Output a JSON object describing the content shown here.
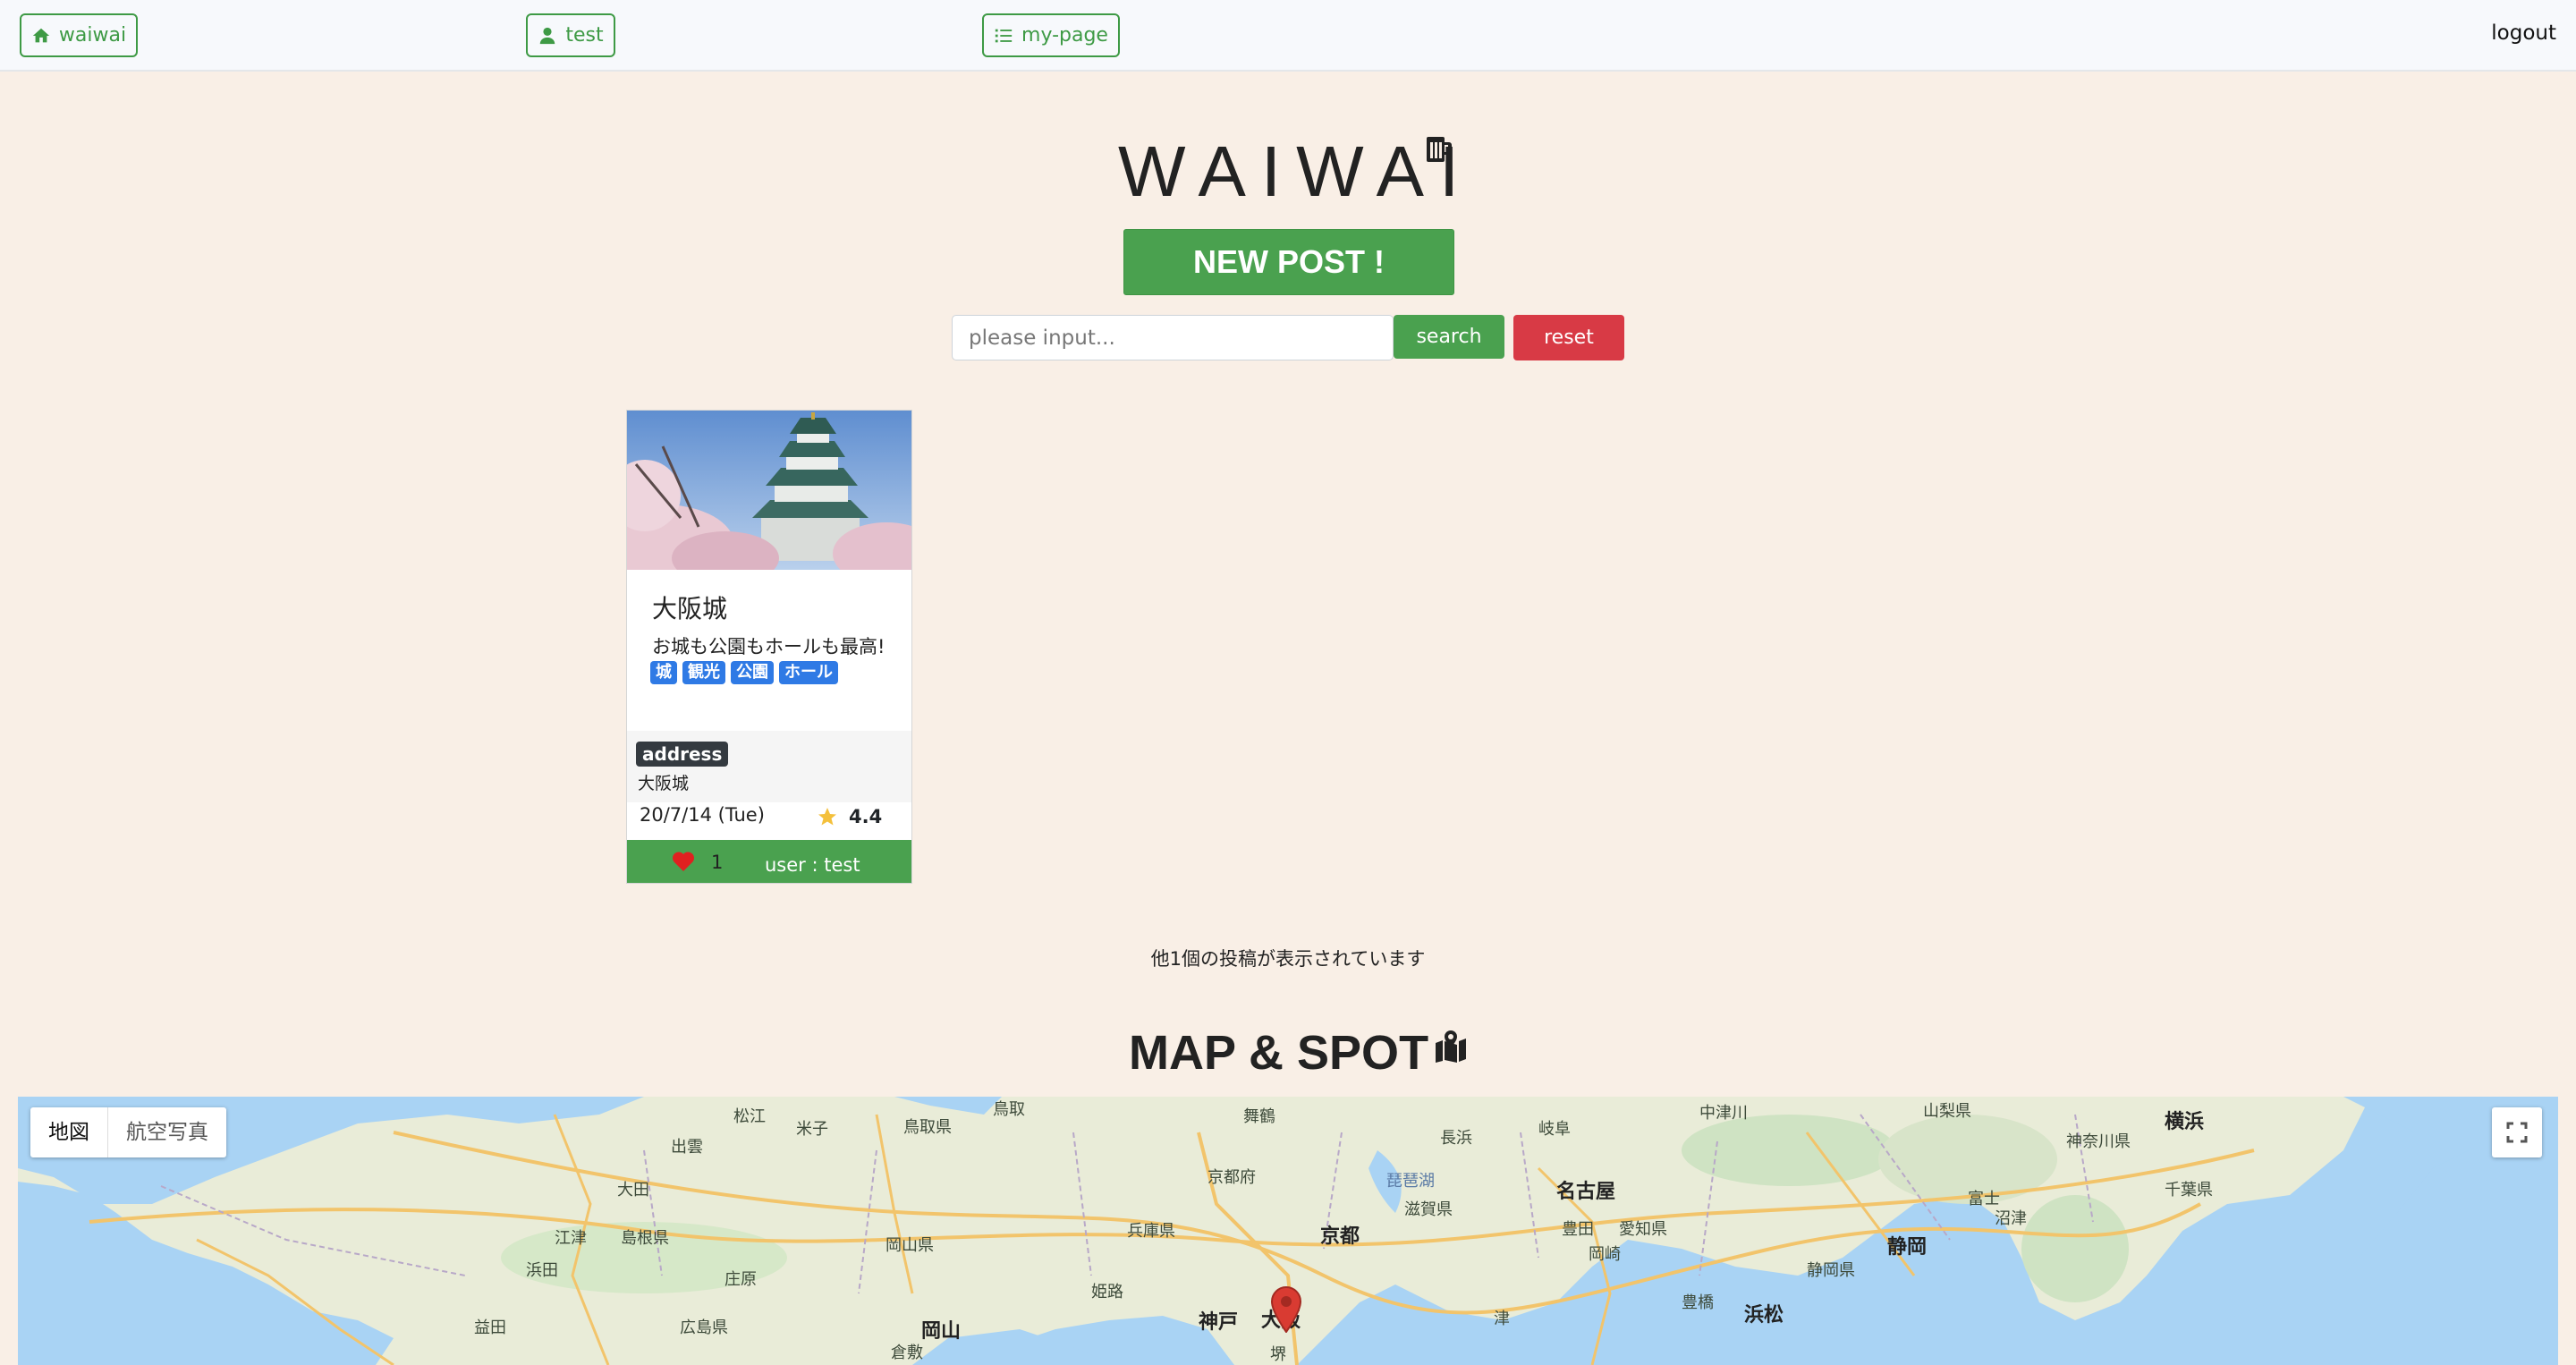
{
  "navbar": {
    "home_label": "waiwai",
    "user_label": "test",
    "mypage_label": "my-page",
    "logout_label": "logout"
  },
  "header": {
    "logo_text": "WAIWAI",
    "new_post_label": "NEW POST !",
    "search_placeholder": "please input...",
    "search_label": "search",
    "reset_label": "reset"
  },
  "post": {
    "title": "大阪城",
    "description": "お城も公園もホールも最高!",
    "tags": [
      "城",
      "観光",
      "公園",
      "ホール"
    ],
    "address_label": "address",
    "address": "大阪城",
    "date": "20/7/14 (Tue)",
    "rating": "4.4",
    "likes": "1",
    "user": "user : test"
  },
  "count_text": "他1個の投稿が表示されています",
  "map": {
    "title": "MAP & SPOT",
    "type_map": "地図",
    "type_satellite": "航空写真",
    "labels": {
      "matsue": "松江",
      "yonago": "米子",
      "tottori_city": "鳥取",
      "tottori_pref": "鳥取県",
      "maizuru": "舞鶴",
      "nagahama": "長浜",
      "gifu": "岐阜",
      "nakatsugawa": "中津川",
      "yamanashi": "山梨県",
      "kanagawa": "神奈川県",
      "yokohama": "横浜",
      "izumo": "出雲",
      "oda": "大田",
      "kyotofu": "京都府",
      "biwako": "琵琶湖",
      "nagoya": "名古屋",
      "fuji": "富士",
      "numazu": "沼津",
      "chiba": "千葉県",
      "gotsu": "江津",
      "shimane": "島根県",
      "okayama_pref": "岡山県",
      "hyogo": "兵庫県",
      "kyoto": "京都",
      "shiga": "滋賀県",
      "toyota": "豊田",
      "aichi": "愛知県",
      "shizuoka": "静岡",
      "hamada": "浜田",
      "shobara": "庄原",
      "okazaki": "岡崎",
      "shizuoka_pref": "静岡県",
      "himeji": "姫路",
      "kobe": "神戸",
      "osaka": "大阪",
      "hamamatsu": "浜松",
      "toyohashi": "豊橋",
      "masuda": "益田",
      "hiroshima": "広島県",
      "okayama": "岡山",
      "kurashiki": "倉敷",
      "sakai": "堺",
      "tsu": "津"
    }
  },
  "colors": {
    "primary_green": "#4aa14f",
    "danger_red": "#d83a45",
    "tag_blue": "#2f7ae5",
    "page_bg": "#f9efe6",
    "heart_red": "#e02020",
    "star_yellow": "#f4c03b"
  },
  "icons": {
    "home": "home-icon",
    "user": "user-icon",
    "list": "list-icon",
    "beer": "beer-mug-icon",
    "map": "map-marker-icon",
    "heart": "heart-icon",
    "star": "star-icon",
    "fullscreen": "fullscreen-icon",
    "pin": "map-pin-icon"
  }
}
